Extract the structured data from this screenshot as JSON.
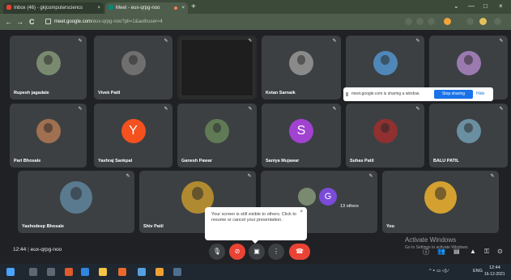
{
  "browser": {
    "tabs": [
      {
        "label": "Inbox (46) - gkjcomputersciencs",
        "close": "×",
        "icon_color": "#ea4335"
      },
      {
        "label": "Meet - eux-qrpg-noo",
        "close": "×",
        "icon_color": "#00897b",
        "recording_dot": "#ff7e5b"
      }
    ],
    "new_tab": "+",
    "window_controls": [
      "⌄",
      "—",
      "□",
      "×"
    ],
    "url_host": "meet.google.com",
    "url_path": "/eux-qrpg-noo?pli=1&authuser=4",
    "nav": [
      "←",
      "→",
      "C"
    ]
  },
  "participants": [
    {
      "name": "Rupesh jagadale",
      "kind": "photo",
      "bg": "#3c4043",
      "avatar": "#7a8a70"
    },
    {
      "name": "Vivek Patil",
      "kind": "photo",
      "bg": "#3c4043",
      "avatar": "#6f6f6f"
    },
    {
      "name": "",
      "kind": "screen",
      "bg": "#2b2b2b",
      "avatar": ""
    },
    {
      "name": "Ketan Sarnaik",
      "kind": "photo",
      "bg": "#3c4043",
      "avatar": "#8a8a8a"
    },
    {
      "name": "",
      "kind": "photo",
      "bg": "#3c4043",
      "avatar": "#4f87b8"
    },
    {
      "name": "",
      "kind": "photo",
      "bg": "#3c4043",
      "avatar": "#9b7ab0"
    },
    {
      "name": "Pari Bhosale",
      "kind": "photo",
      "bg": "#3c4043",
      "avatar": "#a07050"
    },
    {
      "name": "Yashraj Sankpal",
      "kind": "letter",
      "letter": "Y",
      "bg": "#3c4043",
      "avatar": "#f4511e"
    },
    {
      "name": "Ganesh Pawar",
      "kind": "photo",
      "bg": "#3c4043",
      "avatar": "#5f7a55"
    },
    {
      "name": "Saniya Mujawar",
      "kind": "letter",
      "letter": "S",
      "bg": "#3c4043",
      "avatar": "#a142d0"
    },
    {
      "name": "Suhas Patil",
      "kind": "photo",
      "bg": "#3c4043",
      "avatar": "#903030"
    },
    {
      "name": "BALU PATIL",
      "kind": "photo",
      "bg": "#3c4043",
      "avatar": "#6a8fa0"
    },
    {
      "name": "Yashodeep Bhosale",
      "kind": "photo",
      "bg": "#3c4043",
      "avatar": "#5a7a90"
    },
    {
      "name": "Shiv Patil",
      "kind": "photo",
      "bg": "#3c4043",
      "avatar": "#b08a30"
    },
    {
      "name": "13 others",
      "kind": "others",
      "letter": "G",
      "bg": "#3c4043",
      "avatar": "#7b4bd8"
    },
    {
      "name": "You",
      "kind": "photo",
      "bg": "#3c4043",
      "avatar": "#d4a030"
    }
  ],
  "share_banner": {
    "text": "meet.google.com is sharing a window.",
    "stop_label": "Stop sharing",
    "hide_label": "Hide"
  },
  "tooltip": {
    "text": "Your screen is still visible to others. Click to resume or cancel your presentation.",
    "close": "×"
  },
  "meeting": {
    "time": "12:44",
    "code": "eux-qrpg-noo"
  },
  "controls": [
    {
      "name": "mic-button",
      "glyph": "🎙",
      "bg": "#3c4043"
    },
    {
      "name": "camera-off-button",
      "glyph": "⊘",
      "bg": "#ea4335"
    },
    {
      "name": "present-button",
      "glyph": "▣",
      "bg": "#3c4043"
    },
    {
      "name": "more-options-button",
      "glyph": "⋮",
      "bg": "#3c4043"
    },
    {
      "name": "leave-call-button",
      "glyph": "☎",
      "bg": "#ea4335"
    }
  ],
  "watermark": {
    "line1": "Activate Windows",
    "line2": "Go to Settings to activate Windows."
  },
  "taskbar": {
    "time": "12:44",
    "date": "16-12-2021",
    "lang": "ENG"
  }
}
